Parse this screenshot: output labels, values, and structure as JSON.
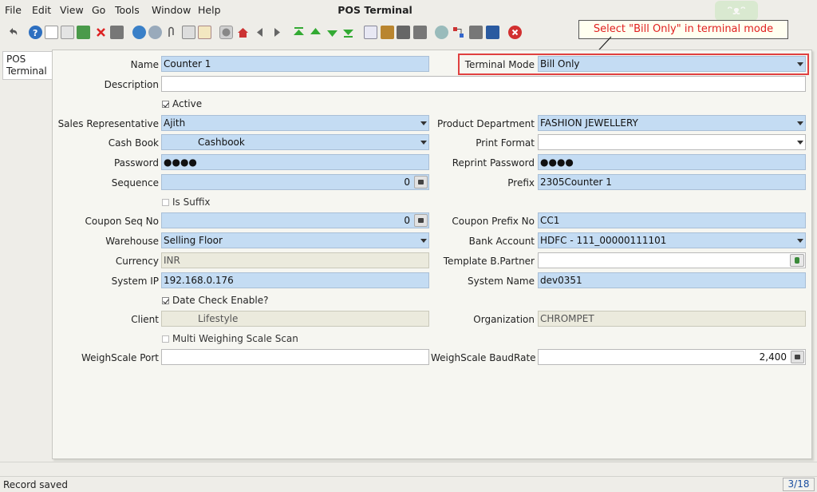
{
  "window": {
    "title": "POS Terminal"
  },
  "menu": [
    "File",
    "Edit",
    "View",
    "Go",
    "Tools",
    "Window",
    "Help"
  ],
  "callout": {
    "text": "Select \"Bill Only\" in terminal mode"
  },
  "tab": {
    "label": "POS Terminal"
  },
  "form": {
    "name": {
      "label": "Name",
      "value": "Counter 1"
    },
    "terminal_mode": {
      "label": "Terminal Mode",
      "value": "Bill Only"
    },
    "description": {
      "label": "Description",
      "value": ""
    },
    "active": {
      "label": "Active",
      "checked": true
    },
    "sales_rep": {
      "label": "Sales Representative",
      "value": "Ajith"
    },
    "product_dept": {
      "label": "Product Department",
      "value": "FASHION JEWELLERY"
    },
    "cash_book": {
      "label": "Cash Book",
      "value": "Cashbook"
    },
    "print_format": {
      "label": "Print Format",
      "value": ""
    },
    "password": {
      "label": "Password",
      "value": "●●●●"
    },
    "reprint_password": {
      "label": "Reprint Password",
      "value": "●●●●"
    },
    "sequence": {
      "label": "Sequence",
      "value": "0"
    },
    "prefix": {
      "label": "Prefix",
      "value": "2305Counter 1"
    },
    "is_suffix": {
      "label": "Is Suffix",
      "checked": false
    },
    "coupon_seq": {
      "label": "Coupon Seq No",
      "value": "0"
    },
    "coupon_prefix": {
      "label": "Coupon Prefix No",
      "value": "CC1"
    },
    "warehouse": {
      "label": "Warehouse",
      "value": "Selling Floor"
    },
    "bank_account": {
      "label": "Bank Account",
      "value": "HDFC - 111_00000111101"
    },
    "currency": {
      "label": "Currency",
      "value": "INR"
    },
    "template_bp": {
      "label": "Template B.Partner",
      "value": ""
    },
    "system_ip": {
      "label": "System IP",
      "value": "192.168.0.176"
    },
    "system_name": {
      "label": "System Name",
      "value": "dev0351"
    },
    "date_check": {
      "label": "Date Check Enable?",
      "checked": true
    },
    "client": {
      "label": "Client",
      "value": "Lifestyle"
    },
    "organization": {
      "label": "Organization",
      "value": "CHROMPET"
    },
    "multi_scale": {
      "label": "Multi Weighing Scale Scan",
      "checked": false
    },
    "weighscale_port": {
      "label": "WeighScale Port",
      "value": ""
    },
    "weighscale_baud": {
      "label": "WeighScale BaudRate",
      "value": "2,400"
    }
  },
  "status": {
    "message": "Record saved",
    "count": "3/18"
  },
  "colors": {
    "field_mandatory": "#c4dcf3",
    "field_readonly": "#ebeadd",
    "callout_text": "#e02020",
    "highlight_frame": "#e04040"
  }
}
